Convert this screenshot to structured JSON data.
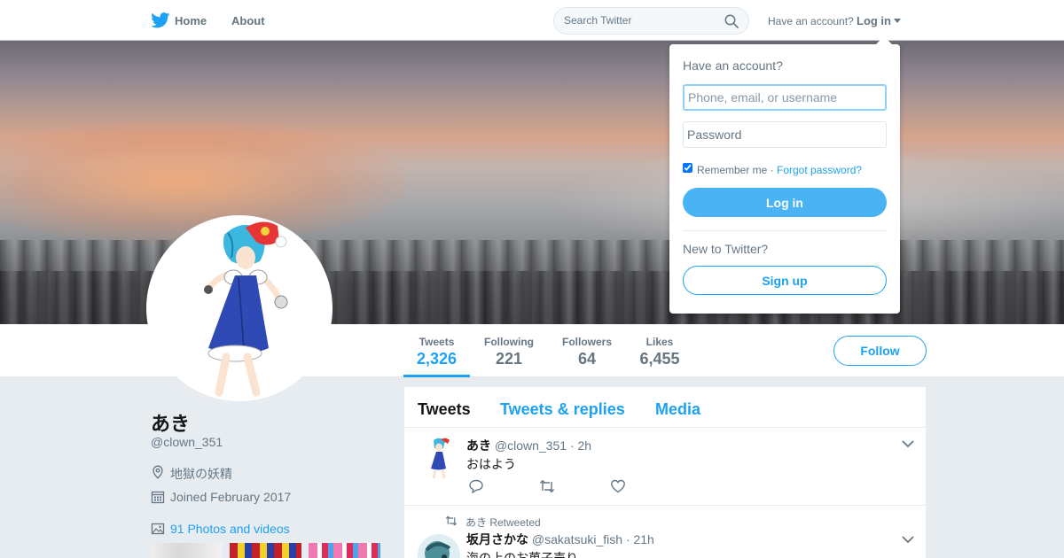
{
  "topbar": {
    "home_label": "Home",
    "about_label": "About",
    "search_placeholder": "Search Twitter",
    "have_account": "Have an account?",
    "login_label": "Log in",
    "brand_color": "#1da1f2"
  },
  "profile": {
    "name": "あき",
    "handle": "@clown_351",
    "location": "地獄の妖精",
    "joined": "Joined February 2017",
    "photos_label": "91 Photos and videos"
  },
  "stats": [
    {
      "label": "Tweets",
      "value": "2,326"
    },
    {
      "label": "Following",
      "value": "221"
    },
    {
      "label": "Followers",
      "value": "64"
    },
    {
      "label": "Likes",
      "value": "6,455"
    }
  ],
  "follow_label": "Follow",
  "timeline": {
    "tabs": [
      "Tweets",
      "Tweets & replies",
      "Media"
    ],
    "tweets": [
      {
        "name": "あき",
        "handle": "@clown_351",
        "time": "· 2h",
        "text": "おはよう"
      },
      {
        "retweet_note": "あき Retweeted",
        "name": "坂月さかな",
        "handle": "@sakatsuki_fish",
        "time": "· 21h",
        "text": "海の上のお菓子売り"
      }
    ]
  },
  "login_dropdown": {
    "title": "Have an account?",
    "username_placeholder": "Phone, email, or username",
    "password_placeholder": "Password",
    "remember_label": "Remember me ·",
    "forgot_label": "Forgot password?",
    "login_button": "Log in",
    "new_label": "New to Twitter?",
    "signup_button": "Sign up"
  },
  "icons": {
    "logo": "twitter-bird-icon",
    "search": "magnifier-icon",
    "location": "map-pin-icon",
    "calendar": "calendar-icon",
    "photos": "image-icon",
    "reply": "speech-bubble-icon",
    "retweet": "retweet-arrows-icon",
    "like": "heart-icon",
    "more": "chevron-down-icon"
  }
}
